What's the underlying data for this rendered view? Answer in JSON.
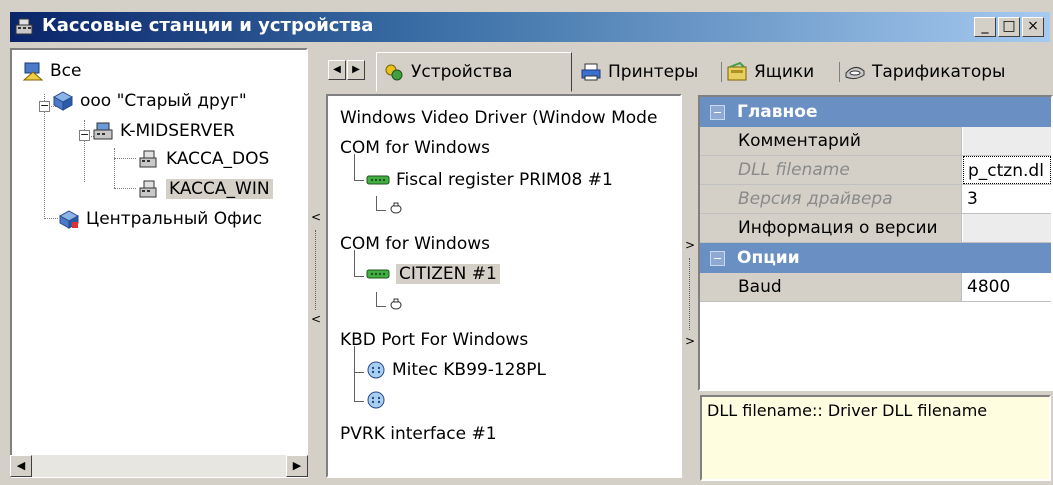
{
  "window": {
    "title": "Кассовые станции и устройства",
    "controls": {
      "minimize": "_",
      "maximize": "□",
      "close": "×"
    }
  },
  "tree": {
    "root": "Все",
    "company": "ооо \"Старый друг\"",
    "server": "K-MIDSERVER",
    "stations": [
      "KACCA_DOS",
      "KACCA_WIN"
    ],
    "office": "Центральный Офис",
    "selected": "KACCA_WIN"
  },
  "tabs": [
    {
      "label": "Устройства",
      "icon": "devices-icon",
      "active": true
    },
    {
      "label": "Принтеры",
      "icon": "printer-icon"
    },
    {
      "label": "Ящики",
      "icon": "drawer-icon"
    },
    {
      "label": "Тарификаторы",
      "icon": "tariff-icon"
    }
  ],
  "devices": [
    {
      "text": "Windows Video Driver (Window Mode",
      "level": 0
    },
    {
      "text": "COM for Windows",
      "level": 0
    },
    {
      "text": "Fiscal register PRIM08 #1",
      "level": 1,
      "icon": "com-port-icon"
    },
    {
      "text": "",
      "level": 2,
      "icon": "device-icon"
    },
    {
      "text": "COM for Windows",
      "level": 0
    },
    {
      "text": "CITIZEN #1",
      "level": 1,
      "icon": "com-port-icon",
      "selected": true
    },
    {
      "text": "",
      "level": 2,
      "icon": "device-icon"
    },
    {
      "text": "KBD Port For Windows",
      "level": 0
    },
    {
      "text": "Mitec KB99-128PL",
      "level": 1,
      "icon": "keyboard-port-icon"
    },
    {
      "text": "",
      "level": 1,
      "icon": "keyboard-port-icon"
    },
    {
      "text": "PVRK interface #1",
      "level": 0
    }
  ],
  "properties": {
    "groups": [
      {
        "name": "Главное",
        "rows": [
          {
            "name": "Комментарий",
            "value": ""
          },
          {
            "name": "DLL filename",
            "value": "p_ctzn.dl",
            "disabled": true
          },
          {
            "name": "Версия драйвера",
            "value": "3",
            "disabled": true
          },
          {
            "name": "Информация о версии",
            "value": ""
          }
        ]
      },
      {
        "name": "Опции",
        "rows": [
          {
            "name": "Baud",
            "value": "4800"
          }
        ]
      }
    ]
  },
  "description": "DLL filename:: Driver DLL filename",
  "colors": {
    "titlebar_start": "#0a246a",
    "group_header": "#6a8fc2",
    "description_bg": "#fffde0",
    "selection": "#d4d0c8"
  }
}
